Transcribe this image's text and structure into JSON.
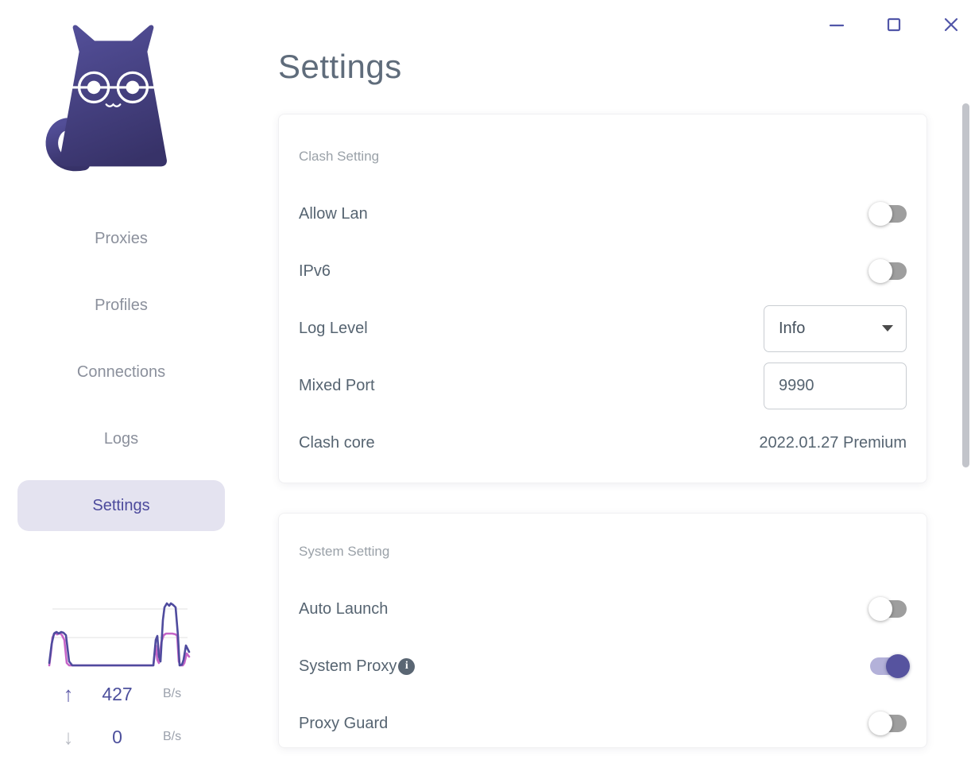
{
  "window": {
    "controls": [
      {
        "name": "minimize"
      },
      {
        "name": "maximize"
      },
      {
        "name": "close"
      }
    ]
  },
  "colors": {
    "accent": "#5156a8",
    "sidebar_active_bg": "#e4e3f0",
    "sidebar_active_text": "#4c4a9c",
    "nav_text": "#8b909c",
    "title_text": "#5f6c7b",
    "label_text": "#566471",
    "section_header_text": "#9aa1a8",
    "toggle_on_knob": "#56539f",
    "toggle_on_track": "#b3b1d9",
    "toggle_off_knob": "#ffffff",
    "toggle_off_track": "#9e9e9e",
    "upload_line_color": "#4f4b9e",
    "download_line_color": "#c665c8"
  },
  "sidebar": {
    "logo": "clash-cat-logo",
    "nav": [
      {
        "label": "Proxies",
        "active": false
      },
      {
        "label": "Profiles",
        "active": false
      },
      {
        "label": "Connections",
        "active": false
      },
      {
        "label": "Logs",
        "active": false
      },
      {
        "label": "Settings",
        "active": true
      }
    ],
    "traffic": {
      "upload": {
        "value": "427",
        "unit": "B/s"
      },
      "download": {
        "value": "0",
        "unit": "B/s"
      }
    }
  },
  "main": {
    "title": "Settings",
    "cards": [
      {
        "header": "Clash Setting",
        "rows": [
          {
            "label": "Allow Lan",
            "control": "toggle",
            "state": "off"
          },
          {
            "label": "IPv6",
            "control": "toggle",
            "state": "off"
          },
          {
            "label": "Log Level",
            "control": "select",
            "value": "Info"
          },
          {
            "label": "Mixed Port",
            "control": "input",
            "value": "9990"
          },
          {
            "label": "Clash core",
            "control": "text",
            "value": "2022.01.27 Premium"
          }
        ]
      },
      {
        "header": "System Setting",
        "rows": [
          {
            "label": "Auto Launch",
            "control": "toggle",
            "state": "off"
          },
          {
            "label": "System Proxy",
            "control": "toggle",
            "state": "on",
            "info_icon": true
          },
          {
            "label": "Proxy Guard",
            "control": "toggle",
            "state": "off"
          }
        ]
      }
    ]
  }
}
